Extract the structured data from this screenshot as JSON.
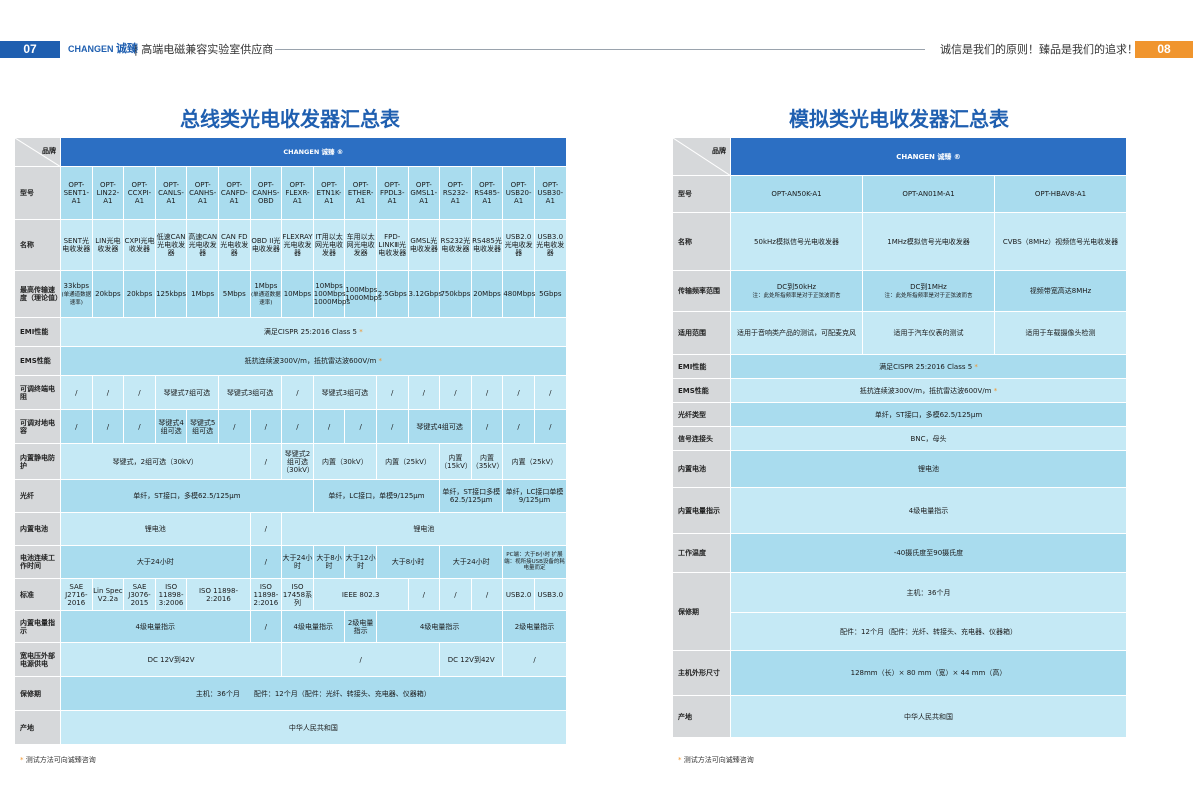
{
  "header": {
    "page_left": "07",
    "page_right": "08",
    "brand_en": "CHANGEN",
    "brand_cn": "诚臻",
    "tagline": "| 高端电磁兼容实验室供应商",
    "slogan": "诚信是我们的原则！臻品是我们的追求！"
  },
  "left": {
    "title": "总线类光电收发器汇总表",
    "brand_row_label": "品牌",
    "brand_header": "CHANGEN 诚臻 ®",
    "rows": {
      "model": "型号",
      "name": "名称",
      "speed": "最高传输速度（理论值）",
      "emi": "EMI性能",
      "ems": "EMS性能",
      "term_res": "可调终端电阻",
      "gnd_cap": "可调对地电容",
      "esd": "内置静电防护",
      "fiber": "光纤",
      "battery": "内置电池",
      "runtime": "电池连续工作时间",
      "standard": "标准",
      "level": "内置电量指示",
      "ext_power": "宽电压外部电源供电",
      "warranty": "保修期",
      "origin": "产地"
    },
    "models": [
      "OPT-SENT1-A1",
      "OPT-LIN22-A1",
      "OPT-CCXPI-A1",
      "OPT-CANLS-A1",
      "OPT-CANHS-A1",
      "OPT-CANFD-A1",
      "OPT-CANHS-OBD",
      "OPT-FLEXR-A1",
      "OPT-ETN1K-A1",
      "OPT-ETHER-A1",
      "OPT-FPDL3-A1",
      "OPT-GMSL1-A1",
      "OPT-RS232-A1",
      "OPT-RS485-A1",
      "OPT-USB20-A1",
      "OPT-USB30-A1"
    ],
    "names": [
      "SENT光电收发器",
      "LIN光电收发器",
      "CXPI光电收发器",
      "低速CAN光电收发器",
      "高速CAN光电收发器",
      "CAN FD光电收发器",
      "OBD II光电收发器",
      "FLEXRAY光电收发器",
      "IT用以太网光电收发器",
      "车用以太网光电收发器",
      "FPD-LINKⅢ光电收发器",
      "GMSL光电收发器",
      "RS232光电收发器",
      "RS485光电收发器",
      "USB2.0光电收发器",
      "USB3.0光电收发器"
    ],
    "speeds": [
      "33kbps",
      "20kbps",
      "20kbps",
      "125kbps",
      "1Mbps",
      "5Mbps",
      "1Mbps",
      "10Mbps",
      "10Mbps 100Mbps 1000Mbps",
      "100Mbps 1000Mbps",
      "2.5Gbps",
      "3.12Gbps",
      "750kbps",
      "20Mbps",
      "480Mbps",
      "5Gbps"
    ],
    "speed_note_1": "(单通道数据速率)",
    "speed_note_7": "(单通道数据速率)",
    "emi": "满足CISPR 25:2016 Class 5",
    "ems": "抵抗连续波300V/m，抵抗雷达波600V/m",
    "slash": "/",
    "term_a": "琴键式7组可选",
    "term_b": "琴键式3组可选",
    "term_c": "琴键式3组可选",
    "cap_a": "琴键式4组可选",
    "cap_b": "琴键式5组可选",
    "cap_c": "琴键式4组可选",
    "esd_a": "琴键式，2组可选（30kV）",
    "esd_b": "琴键式2组可选（30kV）",
    "esd_c": "内置（30kV）",
    "esd_d": "内置（25kV）",
    "esd_e": "内置（15kV）",
    "esd_f": "内置（35kV）",
    "esd_g": "内置（25kV）",
    "fiber_a": "单纤，ST接口，多模62.5/125μm",
    "fiber_b": "单纤，LC接口，单模9/125μm",
    "fiber_c": "单纤，ST接口多模62.5/125μm",
    "fiber_d": "单纤，LC接口单模9/125μm",
    "battery": "锂电池",
    "runtime_a": "大于24小时",
    "runtime_b": "大于24小时",
    "runtime_c": "大于8小时",
    "runtime_d": "大于12小时",
    "runtime_e": "大于8小时",
    "runtime_f": "大于24小时",
    "runtime_g": "PC端：大于8小时 扩展端：视所接USB设备的耗电量而定",
    "std_1": "SAE J2716-2016",
    "std_2": "Lin Spec V2.2a",
    "std_3": "SAE J3076-2015",
    "std_4": "ISO 11898-3:2006",
    "std_5": "ISO 11898-2:2016",
    "std_6": "ISO 11898-2:2016",
    "std_7": "ISO 17458系列",
    "std_8": "IEEE 802.3",
    "std_9": "USB2.0",
    "std_10": "USB3.0",
    "level_a": "4级电量指示",
    "level_b": "4级电量指示",
    "level_c": "2级电量指示",
    "level_d": "4级电量指示",
    "level_e": "2级电量指示",
    "power_a": "DC 12V到42V",
    "power_b": "DC 12V到42V",
    "warranty": "主机：36个月　　配件：12个月（配件：光纤、转接头、充电器、仪器箱）",
    "origin": "中华人民共和国",
    "footnote": "测试方法可向诚臻咨询"
  },
  "right": {
    "title": "模拟类光电收发器汇总表",
    "brand_row_label": "品牌",
    "brand_header": "CHANGEN 诚臻 ®",
    "rows": {
      "model": "型号",
      "name": "名称",
      "band": "传输频率范围",
      "usage": "适用范围",
      "emi": "EMI性能",
      "ems": "EMS性能",
      "fiber": "光纤类型",
      "connector": "信号连接头",
      "battery": "内置电池",
      "level": "内置电量指示",
      "temp": "工作温度",
      "warranty": "保修期",
      "size": "主机外形尺寸",
      "origin": "产地"
    },
    "models": [
      "OPT-AN50K-A1",
      "OPT-AN01M-A1",
      "OPT-HBAV8-A1"
    ],
    "names": [
      "50kHz模拟信号光电收发器",
      "1MHz模拟信号光电收发器",
      "CVBS（8MHz）视频信号光电收发器"
    ],
    "band_1": "DC到50kHz",
    "band_1_note": "注：此处所指频率是对于正弦波而言",
    "band_2": "DC到1MHz",
    "band_2_note": "注：此处所指频率是对于正弦波而言",
    "band_3": "视频带宽高达8MHz",
    "usage_1": "适用于音响类产品的测试，可配麦克风",
    "usage_2": "适用于汽车仪表的测试",
    "usage_3": "适用于车载摄像头检测",
    "emi": "满足CISPR 25:2016 Class 5",
    "ems": "抵抗连续波300V/m，抵抗雷达波600V/m",
    "fiber": "单纤，ST接口，多模62.5/125μm",
    "connector": "BNC，母头",
    "battery": "锂电池",
    "level": "4级电量指示",
    "temp": "-40摄氏度至90摄氏度",
    "warranty_host": "主机：36个月",
    "warranty_acc": "配件：12个月（配件：光纤、转接头、充电器、仪器箱）",
    "size": "128mm（长）× 80 mm（宽）× 44 mm（高）",
    "origin": "中华人民共和国",
    "footnote": "测试方法可向诚臻咨询"
  },
  "colors": {
    "blue": "#1f5fb0",
    "header_blue": "#2c6fc3",
    "cell": "#a9dcee",
    "label": "#d6d8da",
    "orange": "#f0952e"
  }
}
